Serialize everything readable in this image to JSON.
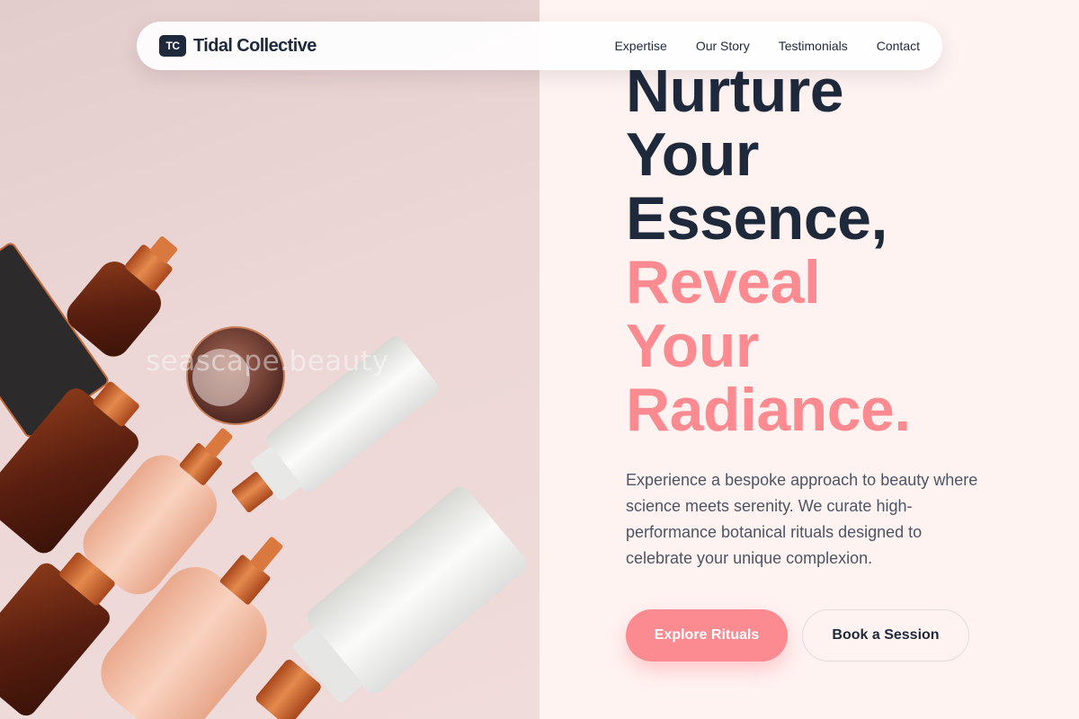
{
  "brand": {
    "mark": "TC",
    "name": "Tidal Collective"
  },
  "nav": {
    "links": [
      "Expertise",
      "Our Story",
      "Testimonials",
      "Contact"
    ]
  },
  "hero": {
    "heading_dark": [
      "Nurture",
      "Your",
      "Essence,"
    ],
    "heading_accent": [
      "Reveal",
      "Your",
      "Radiance."
    ],
    "description": "Experience a bespoke approach to beauty where science meets serenity. We curate high-performance botanical rituals designed to celebrate your unique complexion.",
    "primary_cta": "Explore Rituals",
    "secondary_cta": "Book a Session",
    "image_watermark": "seascape.beauty"
  },
  "colors": {
    "accent": "#fb8a91",
    "dark": "#1e293b",
    "panel_bg": "#fff3f2",
    "text_muted": "#4b5563"
  },
  "icons": [
    "brand-logo-mark"
  ]
}
